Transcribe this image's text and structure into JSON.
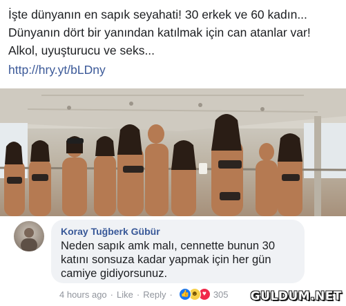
{
  "post": {
    "text": "İşte dünyanın en sapık seyahati! 30 erkek ve 60 kadın... Dünyanın dört bir yanından katılmak için can atanlar var! Alkol, uyuşturucu ve seks...",
    "link": "http://hry.yt/bLDny"
  },
  "photo": {
    "icon": "party-photo"
  },
  "comment": {
    "author": "Koray Tuğberk Gübür",
    "text": "Neden sapık amk malı, cennette bunun 30 katını sonsuza kadar yapmak için her gün camiye gidiyorsunuz.",
    "time": "4 hours ago",
    "like_label": "Like",
    "reply_label": "Reply",
    "separator": "·",
    "reactions": [
      "like-icon",
      "haha-icon",
      "love-icon"
    ],
    "reaction_count": "305"
  },
  "watermark": {
    "text": "GULDUM.NET"
  },
  "colors": {
    "link": "#3b5998",
    "author": "#385898",
    "bubble": "#f0f2f5",
    "like": "#1877f2",
    "love": "#f02849",
    "haha": "#f7d04a"
  }
}
